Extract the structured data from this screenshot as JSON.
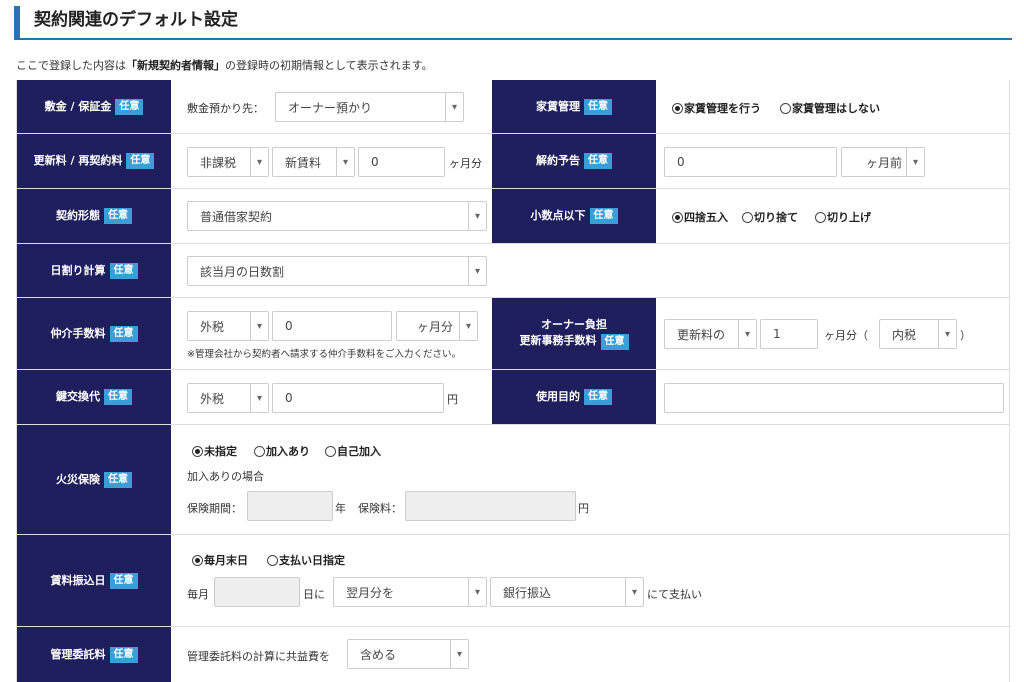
{
  "header": {
    "title": "契約関連のデフォルト設定"
  },
  "intro": {
    "prefix": "ここで登録した内容は",
    "bold": "「新規契約者情報」",
    "suffix": "の登録時の初期情報として表示されます。"
  },
  "badge": "任意",
  "rows": {
    "deposit": {
      "label": "敷金 / 保証金",
      "prefix": "敷金預かり先：",
      "select": "オーナー預かり"
    },
    "rent_mgmt": {
      "label": "家賃管理",
      "options": [
        "家賃管理を行う",
        "家賃管理はしない"
      ],
      "selected": 0
    },
    "renewal": {
      "label": "更新料 / 再契約料",
      "tax": "非課税",
      "basis": "新賃料",
      "value": "0",
      "unit": "ヶ月分"
    },
    "cancel": {
      "label": "解約予告",
      "value": "0",
      "unit": "ヶ月前"
    },
    "contract_type": {
      "label": "契約形態",
      "select": "普通借家契約"
    },
    "decimal": {
      "label": "小数点以下",
      "options": [
        "四捨五入",
        "切り捨て",
        "切り上げ"
      ],
      "selected": 0
    },
    "prorate": {
      "label": "日割り計算",
      "select": "該当月の日数割"
    },
    "brokerage": {
      "label": "仲介手数料",
      "tax": "外税",
      "value": "0",
      "unit": "ヶ月分",
      "note": "※管理会社から契約者へ請求する仲介手数料をご入力ください。"
    },
    "owner_fee": {
      "label_line1": "オーナー負担",
      "label_line2": "更新事務手数料",
      "basis": "更新料の",
      "value": "1",
      "unit": "ヶ月分（",
      "tax": "内税",
      "close": "）"
    },
    "key_change": {
      "label": "鍵交換代",
      "tax": "外税",
      "value": "0",
      "unit": "円"
    },
    "purpose": {
      "label": "使用目的",
      "value": ""
    },
    "insurance": {
      "label": "火災保険",
      "options": [
        "未指定",
        "加入あり",
        "自己加入"
      ],
      "selected": 0,
      "sub": "加入ありの場合",
      "period_label": "保険期間：",
      "period_unit": "年",
      "fee_label": "保険料：",
      "fee_unit": "円"
    },
    "rent_transfer": {
      "label": "賃料振込日",
      "options": [
        "毎月末日",
        "支払い日指定"
      ],
      "selected": 0,
      "prefix": "毎月",
      "day_unit": "日に",
      "month_select": "翌月分を",
      "method_select": "銀行振込",
      "suffix": "にて支払い"
    },
    "mgmt_fee": {
      "label": "管理委託料",
      "prefix": "管理委託料の計算に共益費を",
      "select": "含める"
    }
  }
}
